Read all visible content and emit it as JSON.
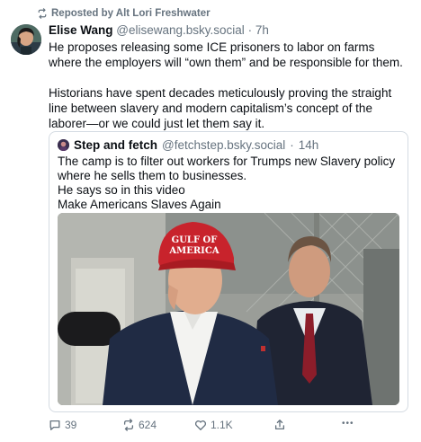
{
  "repost": {
    "text": "Reposted by Alt Lori Freshwater"
  },
  "post": {
    "author_name": "Elise Wang",
    "author_handle": "@elisewang.bsky.social",
    "separator": "·",
    "time": "7h",
    "paragraphs": [
      "He proposes releasing some ICE prisoners to labor on farms where the employers will “own them” and be responsible for them.",
      "Historians have spent decades meticulously proving the straight line between slavery and modern capitalism’s concept of the laborer—or we could just let them say it."
    ]
  },
  "quote": {
    "author_name": "Step and fetch",
    "author_handle": "@fetchstep.bsky.social",
    "separator": "·",
    "time": "14h",
    "lines": [
      "The camp is to filter out workers for Trumps new Slavery policy where he sells them to businesses.",
      "He says so in this video",
      "Make Americans Slaves Again"
    ],
    "hat_text": [
      "GULF OF",
      "AMERICA"
    ]
  },
  "actions": {
    "replies": "39",
    "reposts": "624",
    "likes": "1.1K",
    "share_icon": "share-icon",
    "more": "•••"
  },
  "colors": {
    "text": "#0b0f14",
    "muted": "#66737f",
    "border": "#d4dbe2",
    "hat": "#c8232c"
  }
}
